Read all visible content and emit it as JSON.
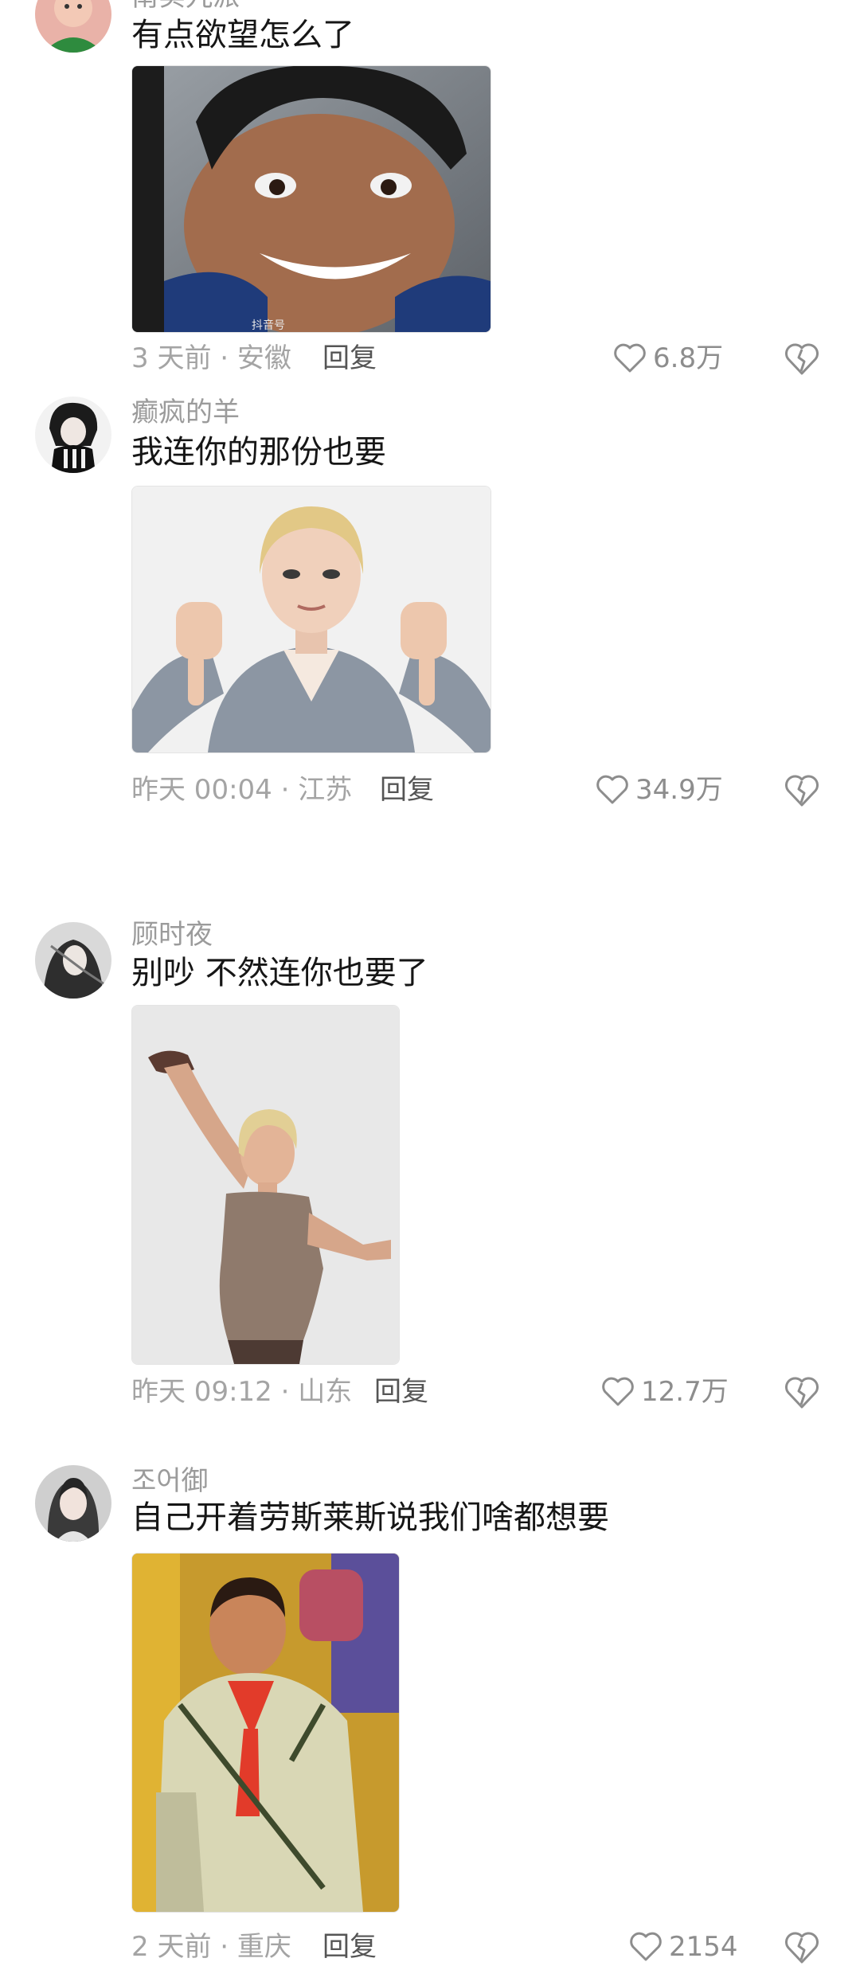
{
  "comments": [
    {
      "username": "南实九派",
      "text": "有点欲望怎么了",
      "image_subject": "smiling-face-meme",
      "watermark": "抖音号",
      "time_location": "3 天前 · 安徽",
      "reply_label": "回复",
      "likes": "6.8万"
    },
    {
      "username": "癫疯的羊",
      "text": "我连你的那份也要",
      "image_subject": "thumbs-down-woman-meme",
      "time_location": "昨天 00:04 · 江苏",
      "reply_label": "回复",
      "likes": "34.9万"
    },
    {
      "username": "顾时夜",
      "text": "别吵 不然连你也要了",
      "image_subject": "beckoning-woman-meme",
      "time_location": "昨天 09:12 · 山东",
      "reply_label": "回复",
      "likes": "12.7万"
    },
    {
      "username": "조어御",
      "text": "自己开着劳斯莱斯说我们啥都想要",
      "image_subject": "boy-red-scarf-meme",
      "time_location": "2 天前 · 重庆",
      "reply_label": "回复",
      "likes": "2154"
    }
  ],
  "icons": {
    "like": "heart-outline-icon",
    "dislike": "broken-heart-icon"
  },
  "colors": {
    "text": "#161616",
    "muted": "#a4a4a4",
    "background": "#ffffff"
  }
}
